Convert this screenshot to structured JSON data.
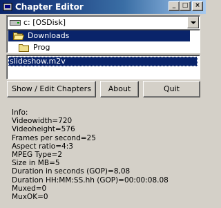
{
  "window": {
    "title": "Chapter Editor",
    "buttons": {
      "minimize": "_",
      "maximize": "□",
      "close": "×"
    }
  },
  "drive_select": {
    "value": "c: [OSDisk]"
  },
  "folders": [
    {
      "label": "Downloads",
      "selected": true
    },
    {
      "label": "Prog",
      "selected": false
    }
  ],
  "files": [
    {
      "label": "slideshow.m2v",
      "selected": true
    }
  ],
  "buttons": {
    "show_edit": "Show / Edit Chapters",
    "about": "About",
    "quit": "Quit"
  },
  "info": {
    "lines": [
      "Info:",
      "Videowidth=720",
      "Videoheight=576",
      "Frames per second=25",
      "Aspect ratio=4:3",
      "MPEG Type=2",
      "Size in MB=5",
      "Duration in seconds (GOP)=8,08",
      "Duration HH:MM:SS.hh (GOP)=00:00:08.08",
      "Muxed=0",
      "MuxOK=0"
    ]
  },
  "colors": {
    "titlebar": "#0a246a",
    "selection": "#0a246a",
    "face": "#d4d0c8"
  },
  "icons": {
    "app": "app-icon",
    "drive": "hard-drive-icon",
    "folder_open": "open-folder-icon",
    "folder": "folder-icon"
  }
}
